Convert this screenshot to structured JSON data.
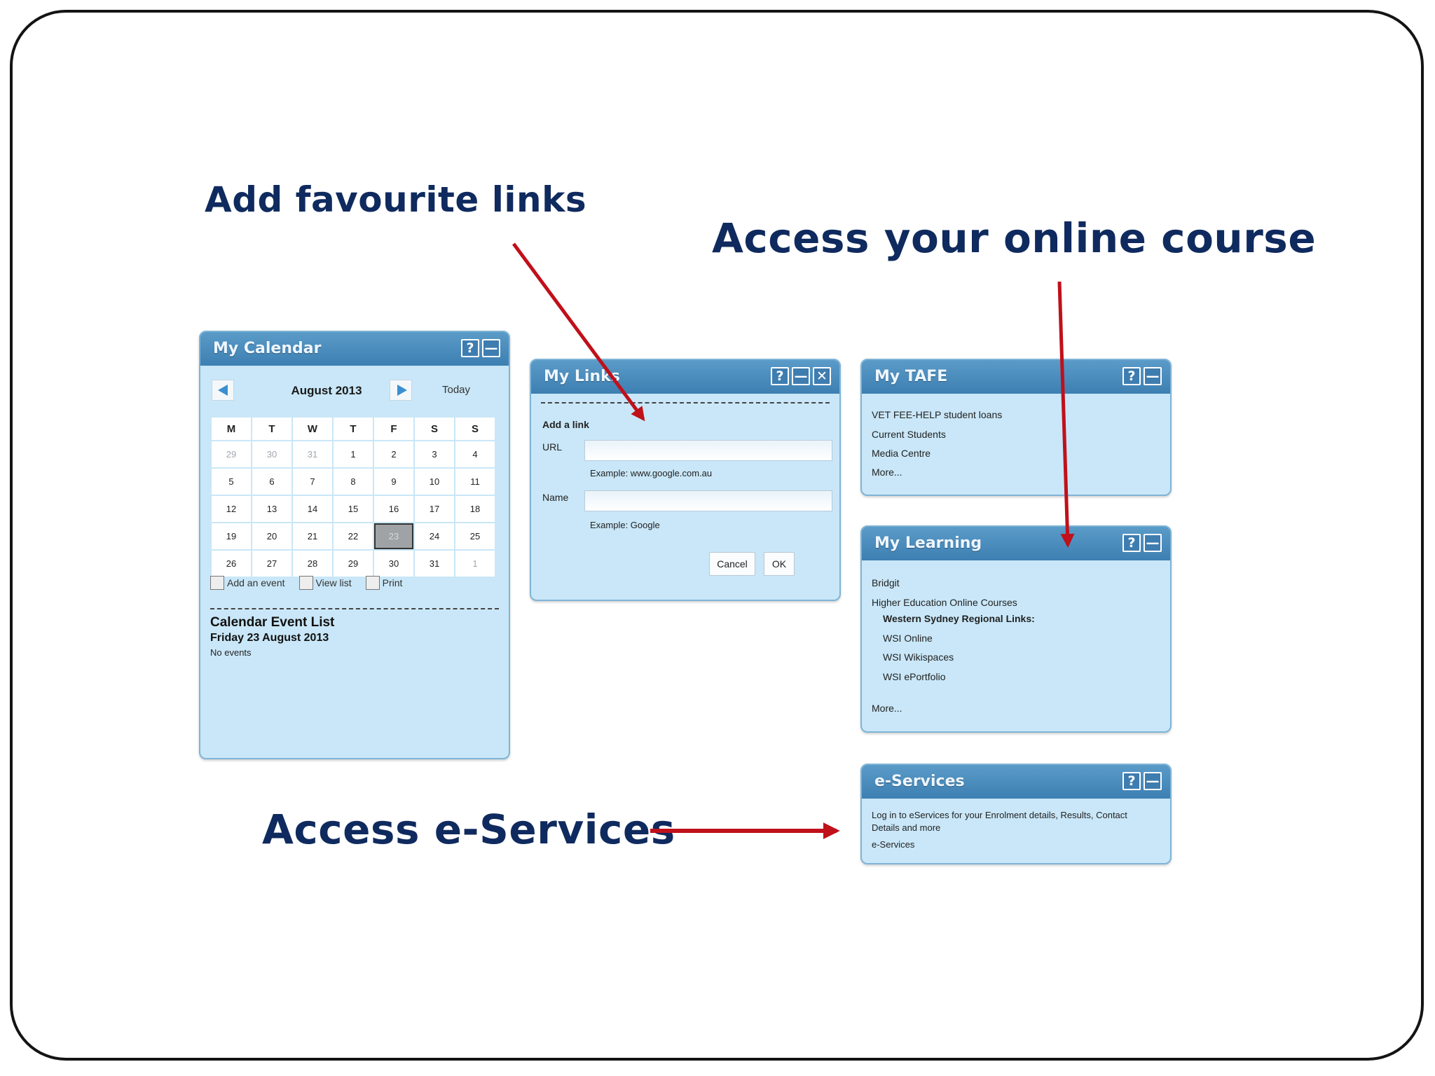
{
  "captions": {
    "favourites": "Add favourite links",
    "course": "Access your online course",
    "eservices": "Access e-Services"
  },
  "arrow_color": "#c0101a",
  "calendar": {
    "title": "My Calendar",
    "help": "?",
    "minimize": "—",
    "month": "August 2013",
    "today": "Today",
    "weekdays": [
      "M",
      "T",
      "W",
      "T",
      "F",
      "S",
      "S"
    ],
    "weeks": [
      [
        "29",
        "30",
        "31",
        "1",
        "2",
        "3",
        "4"
      ],
      [
        "5",
        "6",
        "7",
        "8",
        "9",
        "10",
        "11"
      ],
      [
        "12",
        "13",
        "14",
        "15",
        "16",
        "17",
        "18"
      ],
      [
        "19",
        "20",
        "21",
        "22",
        "23",
        "24",
        "25"
      ],
      [
        "26",
        "27",
        "28",
        "29",
        "30",
        "31",
        "1"
      ]
    ],
    "selected_day": "23",
    "add_event": "Add an event",
    "view_list": "View list",
    "print": "Print",
    "event_list_title": "Calendar Event List",
    "event_date": "Friday 23 August 2013",
    "no_events": "No events"
  },
  "links": {
    "title": "My Links",
    "help": "?",
    "minimize": "—",
    "close": "✕",
    "add_link": "Add a link",
    "url_label": "URL",
    "url_example": "Example: www.google.com.au",
    "name_label": "Name",
    "name_example": "Example: Google",
    "cancel": "Cancel",
    "ok": "OK"
  },
  "tafe": {
    "title": "My TAFE",
    "help": "?",
    "minimize": "—",
    "items": [
      "VET FEE-HELP student loans",
      "Current Students",
      "Media Centre",
      "More..."
    ]
  },
  "learning": {
    "title": "My Learning",
    "help": "?",
    "minimize": "—",
    "bridgit": "Bridgit",
    "higher_ed": "Higher Education Online Courses",
    "regional": "Western Sydney Regional Links:",
    "wsi_online": "WSI Online",
    "wsi_wiki": "WSI Wikispaces",
    "wsi_eportfolio": "WSI ePortfolio",
    "more": "More..."
  },
  "eservices": {
    "title": "e-Services",
    "help": "?",
    "minimize": "—",
    "desc_line1": "Log in to eServices for your Enrolment details, Results, Contact",
    "desc_line2": "Details and more",
    "link": "e-Services"
  }
}
